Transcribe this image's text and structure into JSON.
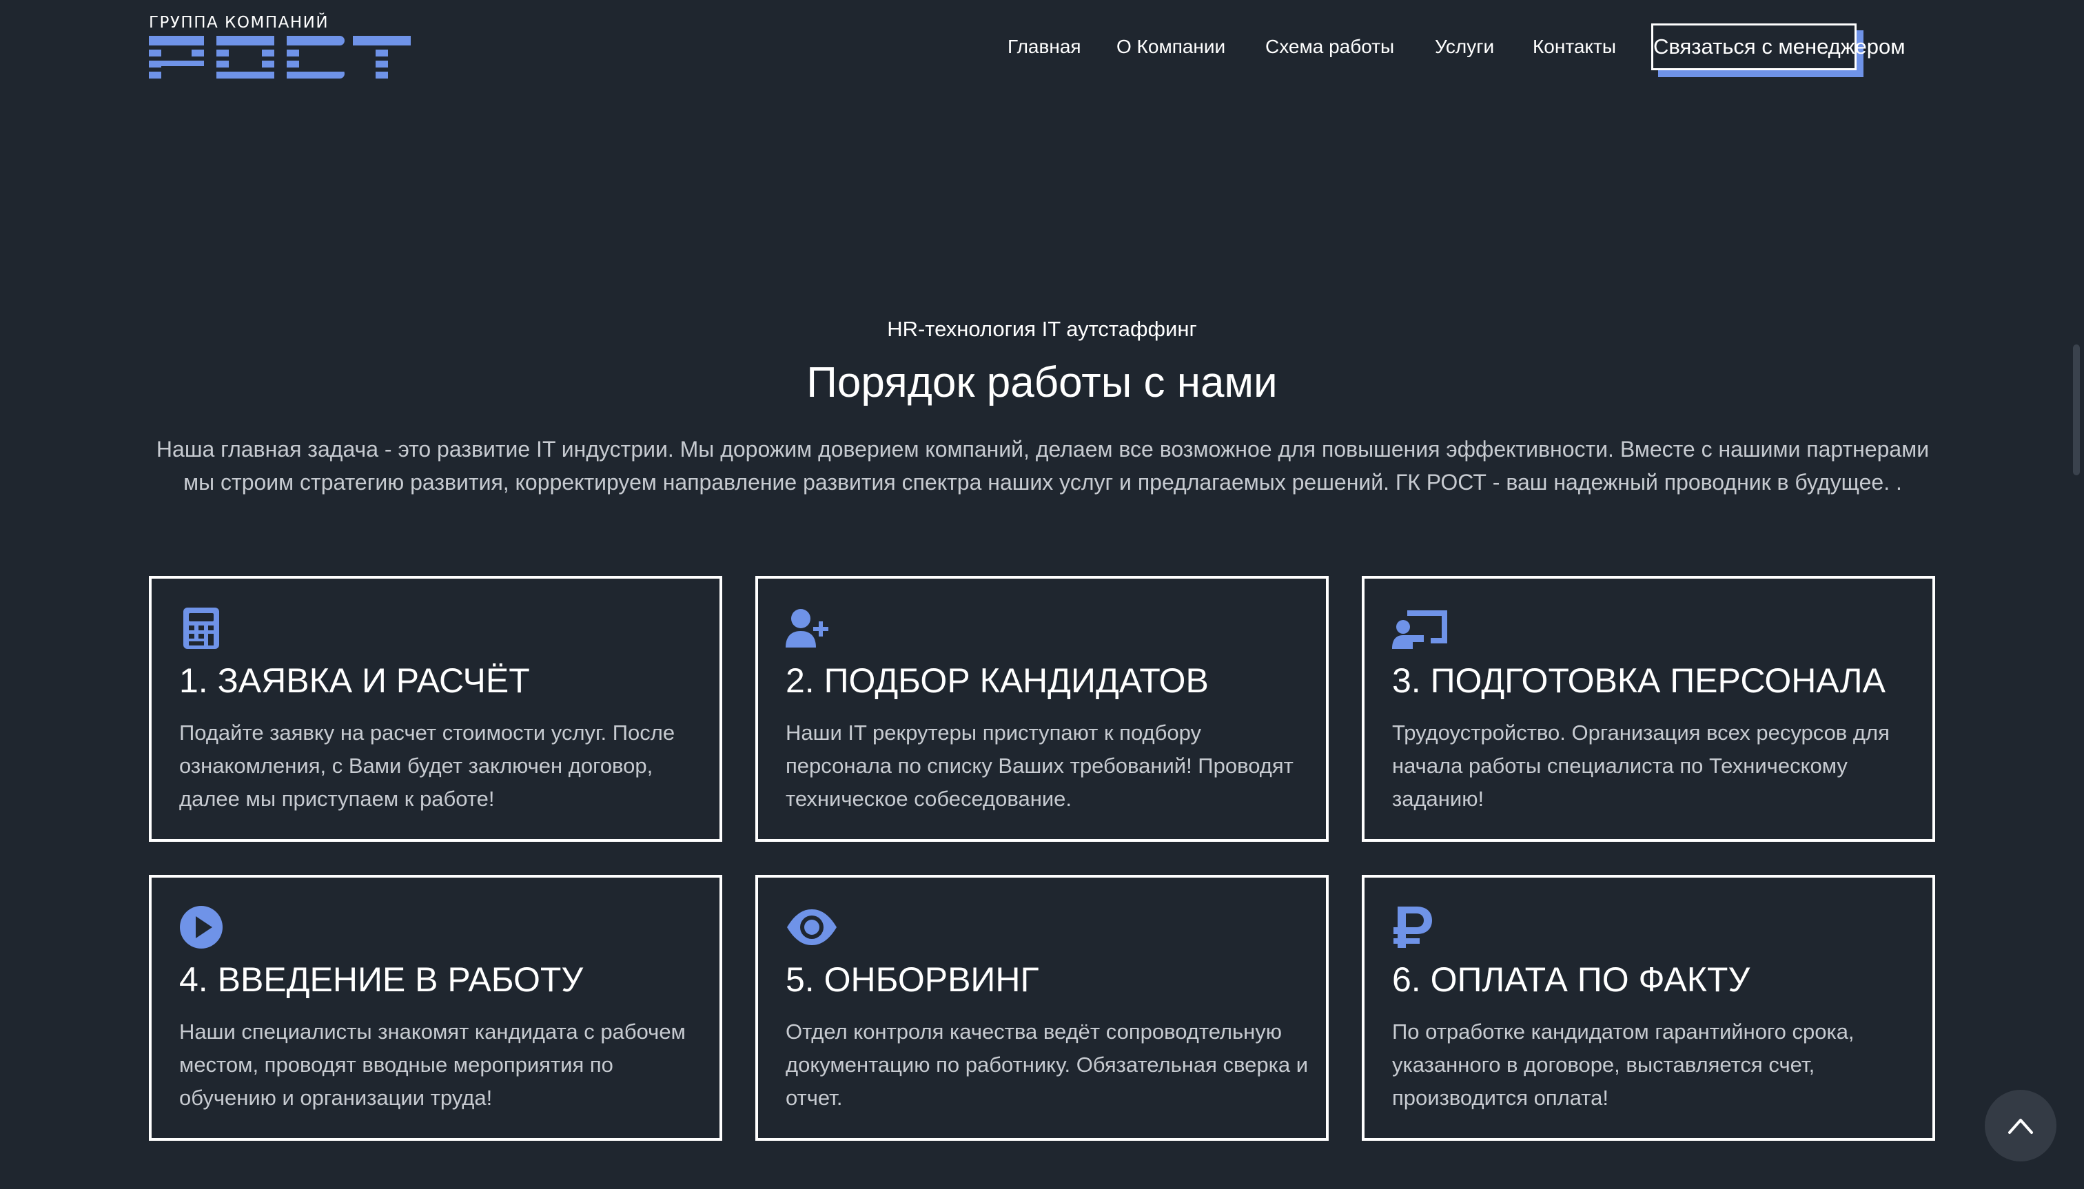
{
  "header": {
    "logo": {
      "caption": "ГРУППА КОМПАНИЙ",
      "word": "РОСТ",
      "color": "#6f93e8"
    },
    "nav": [
      {
        "label": "Главная"
      },
      {
        "label": "О Компании"
      },
      {
        "label": "Схема работы"
      },
      {
        "label": "Услуги"
      },
      {
        "label": "Контакты"
      }
    ],
    "cta_label": "Связаться с менеджером"
  },
  "section": {
    "eyebrow": "HR-технология IT аутстаффинг",
    "title": "Порядок работы с нами",
    "lead": "Наша главная задача - это развитие IT индустрии. Мы дорожим доверием компаний, делаем все возможное для повышения эффективности. Вместе с нашими партнерами мы строим стратегию развития, корректируем направление развития спектра наших услуг и предлагаемых решений. ГК РОСТ - ваш надежный проводник в будущее. ."
  },
  "steps": [
    {
      "icon": "calculator-icon",
      "title": "1. ЗАЯВКА И РАСЧЁТ",
      "text": "Подайте заявку на расчет стоимости услуг. После ознакомления, с Вами будет заключен договор, далее мы приступаем к работе!"
    },
    {
      "icon": "user-plus-icon",
      "title": "2. ПОДБОР КАНДИДАТОВ",
      "text": "Наши IT рекрутеры приступают к подбору персонала по списку Ваших требований! Проводят техническое собеседование."
    },
    {
      "icon": "chalkboard-teacher-icon",
      "title": "3. ПОДГОТОВКА ПЕРСОНАЛА",
      "text": "Трудоустройство. Организация всех ресурсов для начала работы специалиста по Техническому заданию!"
    },
    {
      "icon": "play-circle-icon",
      "title": "4. ВВЕДЕНИЕ В РАБОТУ",
      "text": "Наши специалисты знакомят кандидата с рабочем местом, проводят вводные мероприятия по обучению и организации труда!"
    },
    {
      "icon": "eye-icon",
      "title": "5. ОНБОРВИНГ",
      "text": "Отдел контроля качества ведёт сопроводтельную документацию по работнику. Обязательная сверка и отчет."
    },
    {
      "icon": "ruble-icon",
      "title": "6. ОПЛАТА ПО ФАКТУ",
      "text": "По отработке кандидатом гарантийного срока, указанного в договоре, выставляется счет, производится оплата!"
    }
  ],
  "colors": {
    "background": "#1f262f",
    "accent": "#6f93e8",
    "text": "#ffffff",
    "muted_text": "#c7cbd1"
  },
  "scroll_top_icon": "chevron-up-icon"
}
